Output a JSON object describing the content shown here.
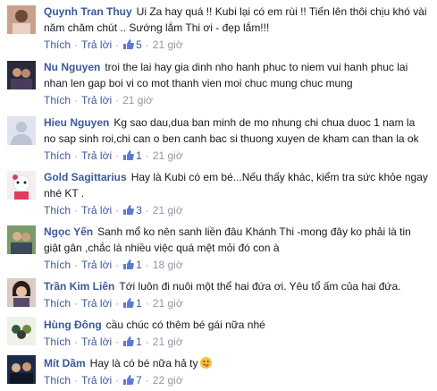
{
  "comments": [
    {
      "author": "Quynh Tran Thuy",
      "line1": "Ui Za hay quá !! Kubi lại có em rùi !! Tiến lên thôi chịu khó vài",
      "line2": "năm chăm chút .. Sướng lắm Thi ơi - đẹp lắm!!!",
      "like_label": "Thích",
      "reply_label": "Trả lời",
      "likes": "5",
      "time": "21 giờ"
    },
    {
      "author": "Nu Nguyen",
      "line1": "troi the lai hay gia dinh nho hanh phuc to niem vui hanh phuc lai",
      "line2": "nhan len gap boi vi co mot thanh vien moi chuc mung chuc mung",
      "like_label": "Thích",
      "reply_label": "Trả lời",
      "likes": "",
      "time": "21 giờ"
    },
    {
      "author": "Hieu Nguyen",
      "line1": "Kg sao dau,dua ban minh de mo nhung chi chua duoc 1 nam la",
      "line2": "no sap sinh roi,chi can o ben canh bac si thuong xuyen de kham can than la ok",
      "like_label": "Thích",
      "reply_label": "Trả lời",
      "likes": "1",
      "time": "21 giờ"
    },
    {
      "author": "Gold Sagittarius",
      "line1": "Hay là Kubi có em bé...Nếu thấy khác, kiểm tra sức khỏe ngay",
      "line2": "nhé KT .",
      "like_label": "Thích",
      "reply_label": "Trả lời",
      "likes": "3",
      "time": "21 giờ"
    },
    {
      "author": "Ngọc Yến",
      "line1": "Sanh mổ ko nên sanh liền đâu Khánh Thi -mong đây ko phải là tin",
      "line2": "giật gân ,chắc là nhiều việc quá mệt mỏi đó con à",
      "like_label": "Thích",
      "reply_label": "Trả lời",
      "likes": "1",
      "time": "18 giờ"
    },
    {
      "author": "Trần Kim Liên",
      "line1": "Tới luôn đi nuôi một thể hai đứa ơi. Yêu tổ ấm của hai đứa.",
      "line2": "",
      "like_label": "Thích",
      "reply_label": "Trả lời",
      "likes": "1",
      "time": "21 giờ"
    },
    {
      "author": "Hùng Đông",
      "line1": "cầu chúc có thêm bé gái nữa nhé",
      "line2": "",
      "like_label": "Thích",
      "reply_label": "Trả lời",
      "likes": "1",
      "time": "21 giờ"
    },
    {
      "author": "Mít Dầm",
      "line1": "Hay là có bé nữa hả ty",
      "line2": "",
      "like_label": "Thích",
      "reply_label": "Trả lời",
      "likes": "7",
      "time": "22 giờ"
    }
  ],
  "colors": {
    "link": "#3b5998",
    "meta": "#9197a3",
    "text": "#141823"
  }
}
